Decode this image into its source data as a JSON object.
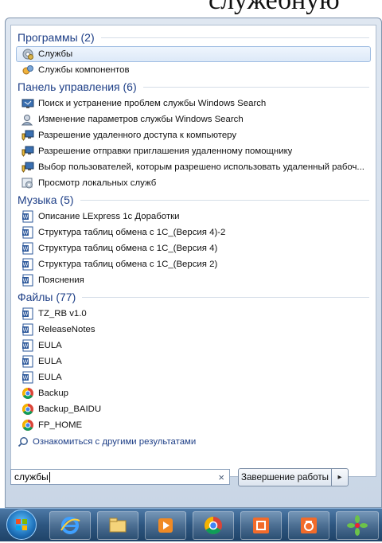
{
  "background_text": "служебную",
  "groups": [
    {
      "title": "Программы (2)",
      "items": [
        {
          "label": "Службы",
          "icon": "services-gear-icon",
          "selected": true
        },
        {
          "label": "Службы компонентов",
          "icon": "component-services-icon"
        }
      ]
    },
    {
      "title": "Панель управления (6)",
      "items": [
        {
          "label": "Поиск и устранение проблем службы Windows Search",
          "icon": "troubleshoot-monitor-icon"
        },
        {
          "label": "Изменение параметров службы Windows Search",
          "icon": "user-search-icon"
        },
        {
          "label": "Разрешение удаленного доступа к компьютеру",
          "icon": "shield-monitor-icon"
        },
        {
          "label": "Разрешение отправки приглашения удаленному помощнику",
          "icon": "shield-monitor-icon"
        },
        {
          "label": "Выбор пользователей, которым разрешено использовать удаленный рабоч...",
          "icon": "shield-monitor-icon"
        },
        {
          "label": "Просмотр локальных служб",
          "icon": "local-services-icon"
        }
      ]
    },
    {
      "title": "Музыка (5)",
      "items": [
        {
          "label": "Описание LExpress 1с Доработки",
          "icon": "word-document-icon"
        },
        {
          "label": "Структура таблиц обмена с 1С_(Версия 4)-2",
          "icon": "word-document-icon"
        },
        {
          "label": "Структура таблиц обмена с 1С_(Версия 4)",
          "icon": "word-document-icon"
        },
        {
          "label": "Структура таблиц обмена с 1С_(Версия 2)",
          "icon": "word-document-icon"
        },
        {
          "label": "Пояснения",
          "icon": "word-document-icon"
        }
      ]
    },
    {
      "title": "Файлы (77)",
      "items": [
        {
          "label": "TZ_RB v1.0",
          "icon": "word-document-icon"
        },
        {
          "label": "ReleaseNotes",
          "icon": "word-document-icon"
        },
        {
          "label": "EULA",
          "icon": "word-document-icon"
        },
        {
          "label": "EULA",
          "icon": "word-document-icon"
        },
        {
          "label": "EULA",
          "icon": "word-document-icon"
        },
        {
          "label": "Backup",
          "icon": "chrome-icon"
        },
        {
          "label": "Backup_BAIDU",
          "icon": "chrome-icon"
        },
        {
          "label": "FP_HOME",
          "icon": "chrome-icon"
        }
      ]
    }
  ],
  "see_more": "Ознакомиться с другими результатами",
  "search": {
    "value": "службы",
    "clear_symbol": "×"
  },
  "shutdown": {
    "label": "Завершение работы",
    "arrow": "▸"
  },
  "taskbar": [
    {
      "name": "internet-explorer-icon"
    },
    {
      "name": "file-explorer-icon"
    },
    {
      "name": "media-player-icon"
    },
    {
      "name": "chrome-icon"
    },
    {
      "name": "screenshot-tool-icon"
    },
    {
      "name": "camera-tool-icon"
    },
    {
      "name": "icq-icon"
    }
  ]
}
